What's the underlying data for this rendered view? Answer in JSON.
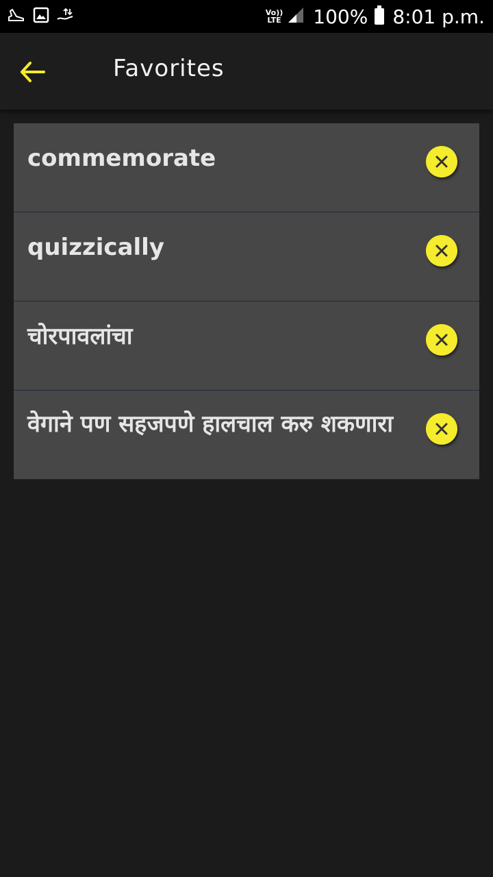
{
  "status_bar": {
    "network_label_top": "Vo))",
    "network_label_bottom": "LTE",
    "battery": "100%",
    "time": "8:01 p.m."
  },
  "app_bar": {
    "title": "Favorites"
  },
  "favorites": [
    {
      "text": "commemorate"
    },
    {
      "text": "quizzically"
    },
    {
      "text": "चोरपावलांचा"
    },
    {
      "text": "वेगाने पण सहजपणे हालचाल करु शकणारा"
    }
  ],
  "colors": {
    "accent": "#f4ec2c",
    "background": "#1b1b1b",
    "item_background": "#474747"
  }
}
